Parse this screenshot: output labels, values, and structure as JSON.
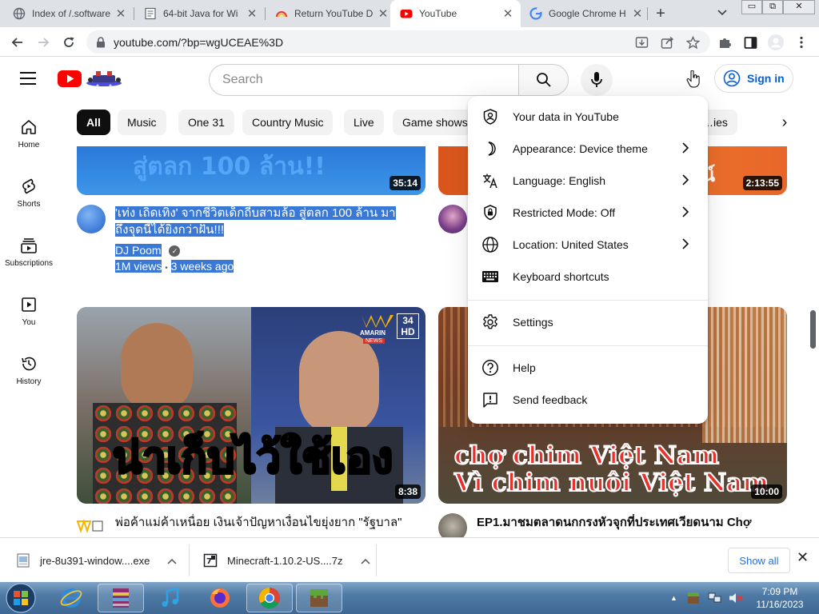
{
  "browser": {
    "tabs": [
      {
        "title": "Index of /.software",
        "icon": "globe-icon",
        "active": false
      },
      {
        "title": "64-bit Java for Wi",
        "icon": "page-icon",
        "active": false
      },
      {
        "title": "Return YouTube D",
        "icon": "rainbow-icon",
        "active": false
      },
      {
        "title": "YouTube",
        "icon": "youtube-icon",
        "active": true
      },
      {
        "title": "Google Chrome H",
        "icon": "google-icon",
        "active": false
      }
    ],
    "new_tab": "+",
    "window_controls": {
      "minimize": "▭",
      "maximize": "⧉",
      "close": "✕"
    },
    "url": "youtube.com/?bp=wgUCEAE%3D"
  },
  "header": {
    "search_placeholder": "Search",
    "signin_label": "Sign in"
  },
  "rail": {
    "items": [
      {
        "label": "Home",
        "icon": "home-icon"
      },
      {
        "label": "Shorts",
        "icon": "shorts-icon"
      },
      {
        "label": "Subscriptions",
        "icon": "subscriptions-icon"
      },
      {
        "label": "You",
        "icon": "you-icon"
      },
      {
        "label": "History",
        "icon": "history-icon"
      }
    ]
  },
  "chips": {
    "items": [
      "All",
      "Music",
      "One 31",
      "Country Music",
      "Live",
      "Game shows",
      "…ies"
    ],
    "active": "All",
    "next": "›"
  },
  "videos": [
    {
      "title_line1": "'เท่ง เถิดเทิง' จากชีวิตเด็กถีบสามล้อ สู่ตลก 100 ล้าน มา",
      "title_line2": "ถึงจุดนี้ได้ยิ่งกว่าฝัน!!!",
      "channel": "DJ Poom",
      "verified": "✓",
      "views": "1M views",
      "dot": "•",
      "age": "3 weeks ago",
      "duration": "35:14",
      "thumb_text": "สู่ตลก 100 ล้าน!!"
    },
    {
      "duration": "2:13:55",
      "thumb_text": "มน์"
    },
    {
      "title_line1": "พ่อค้าแม่ค้าเหนื่อย เงินเจ้าปัญหาเงื่อนไขยุ่งยาก \"รัฐบาล\"",
      "duration": "8:38",
      "thumb_text": "น่าเก็บไว้ใช้เอง",
      "badge_num": "34",
      "badge_hd": "HD",
      "badge_brand": "AMARIN",
      "badge_news": "NEWS"
    },
    {
      "title_line1": "EP1.มาชมตลาดนกกรงหัวจุกที่ประเทศเวียดนาม Chợ",
      "duration": "10:00",
      "thumb_line1": "chợ chim Việt Nam",
      "thumb_line2": "Vì chim nuôi Việt Nam"
    }
  ],
  "menu": {
    "items": [
      {
        "label": "Your data in YouTube",
        "icon": "shield-person-icon",
        "has_submenu": false
      },
      {
        "label": "Appearance: Device theme",
        "icon": "moon-icon",
        "has_submenu": true
      },
      {
        "label": "Language: English",
        "icon": "translate-icon",
        "has_submenu": true
      },
      {
        "label": "Restricted Mode: Off",
        "icon": "restricted-icon",
        "has_submenu": true
      },
      {
        "label": "Location: United States",
        "icon": "globe-icon",
        "has_submenu": true
      },
      {
        "label": "Keyboard shortcuts",
        "icon": "keyboard-icon",
        "has_submenu": false
      },
      {
        "label": "Settings",
        "icon": "gear-icon",
        "has_submenu": false
      },
      {
        "label": "Help",
        "icon": "help-icon",
        "has_submenu": false
      },
      {
        "label": "Send feedback",
        "icon": "feedback-icon",
        "has_submenu": false
      }
    ],
    "chevron": "›"
  },
  "downloads": {
    "items": [
      {
        "name": "jre-8u391-window....exe",
        "icon": "exe-file-icon"
      },
      {
        "name": "Minecraft-1.10.2-US....7z",
        "icon": "archive-file-icon"
      }
    ],
    "chevron": "∧",
    "show_all": "Show all",
    "close": "✕"
  },
  "taskbar": {
    "time": "7:09 PM",
    "date": "11/16/2023",
    "tray_arrow": "▲"
  },
  "colors": {
    "youtube_red": "#ff0000",
    "link_blue": "#065fd4",
    "selection": "#3a78d6",
    "chip_active": "#0f0f0f"
  }
}
